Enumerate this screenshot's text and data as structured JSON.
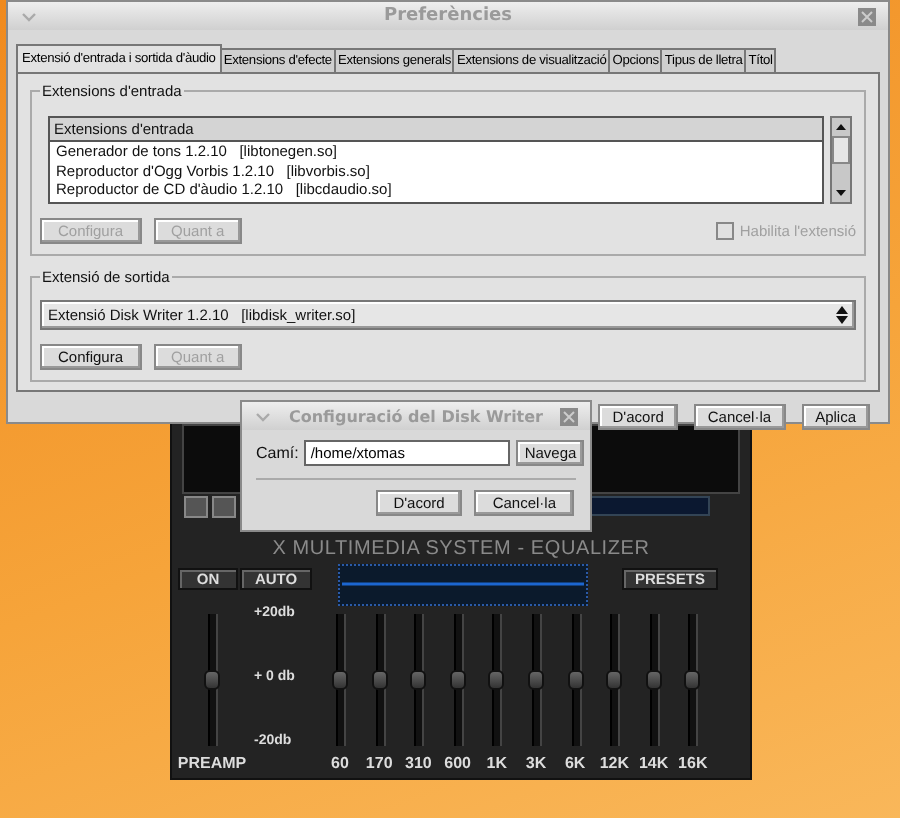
{
  "preferences": {
    "title": "Preferències",
    "tabs": [
      {
        "label": "Extensió d'entrada i sortida d'àudio",
        "selected": true
      },
      {
        "label": "Extensions d'efecte",
        "selected": false
      },
      {
        "label": "Extensions generals",
        "selected": false
      },
      {
        "label": "Extensions de visualització",
        "selected": false
      },
      {
        "label": "Opcions",
        "selected": false
      },
      {
        "label": "Tipus de lletra",
        "selected": false
      },
      {
        "label": "Títol",
        "selected": false
      }
    ],
    "input_section": {
      "legend": "Extensions d'entrada",
      "list": {
        "header": "Extensions d'entrada",
        "rows": [
          "Generador de tons 1.2.10   [libtonegen.so]",
          "Reproductor d'Ogg Vorbis 1.2.10   [libvorbis.so]",
          "Reproductor de CD d'àudio 1.2.10   [libcdaudio.so]"
        ]
      },
      "buttons": [
        {
          "label": "Configura",
          "disabled": true
        },
        {
          "label": "Quant a",
          "disabled": true
        }
      ],
      "checkbox": {
        "label": "Habilita l'extensió",
        "checked": false,
        "disabled": true
      }
    },
    "output_section": {
      "legend": "Extensió de sortida",
      "combo_value": "Extensió Disk Writer 1.2.10   [libdisk_writer.so]",
      "buttons": [
        {
          "label": "Configura",
          "disabled": false
        },
        {
          "label": "Quant a",
          "disabled": true
        }
      ]
    },
    "buttons": [
      "D'acord",
      "Cancel·la",
      "Aplica"
    ]
  },
  "dialog": {
    "title": "Configuració del Disk Writer",
    "field_label": "Camí:",
    "value": "/home/xtomas",
    "browse": "Navega",
    "buttons": [
      "D'acord",
      "Cancel·la"
    ]
  },
  "equalizer": {
    "title": "X MULTIMEDIA SYSTEM - EQUALIZER",
    "on": {
      "label": "ON",
      "selected": false
    },
    "auto": {
      "label": "AUTO",
      "selected": false
    },
    "presets": "PRESETS",
    "scale": [
      "+20db",
      "+ 0 db",
      "-20db"
    ],
    "preamp": {
      "label": "PREAMP",
      "level": 0.5
    },
    "bands": [
      {
        "label": "60",
        "level": 0.5
      },
      {
        "label": "170",
        "level": 0.5
      },
      {
        "label": "310",
        "level": 0.5
      },
      {
        "label": "600",
        "level": 0.5
      },
      {
        "label": "1K",
        "level": 0.5
      },
      {
        "label": "3K",
        "level": 0.5
      },
      {
        "label": "6K",
        "level": 0.5
      },
      {
        "label": "12K",
        "level": 0.5
      },
      {
        "label": "14K",
        "level": 0.5
      },
      {
        "label": "16K",
        "level": 0.5
      }
    ]
  }
}
